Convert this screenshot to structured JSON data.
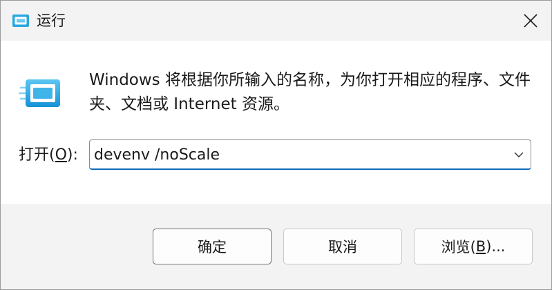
{
  "window": {
    "title": "运行",
    "title_icon": "run-dialog-icon",
    "close_icon": "close-icon"
  },
  "content": {
    "description": "Windows 将根据你所输入的名称，为你打开相应的程序、文件夹、文档或 Internet 资源。",
    "big_icon": "run-dialog-icon",
    "open_label_prefix": "打开(",
    "open_label_accel": "O",
    "open_label_suffix": "):",
    "command_value": "devenv /noScale",
    "dropdown_icon": "chevron-down-icon"
  },
  "buttons": {
    "ok_label": "确定",
    "cancel_label": "取消",
    "browse_prefix": "浏览(",
    "browse_accel": "B",
    "browse_suffix": ")..."
  },
  "colors": {
    "accent": "#0f6cbd",
    "titlebar_bg": "#f3f3f3",
    "icon_cyan": "#29a8e0"
  }
}
